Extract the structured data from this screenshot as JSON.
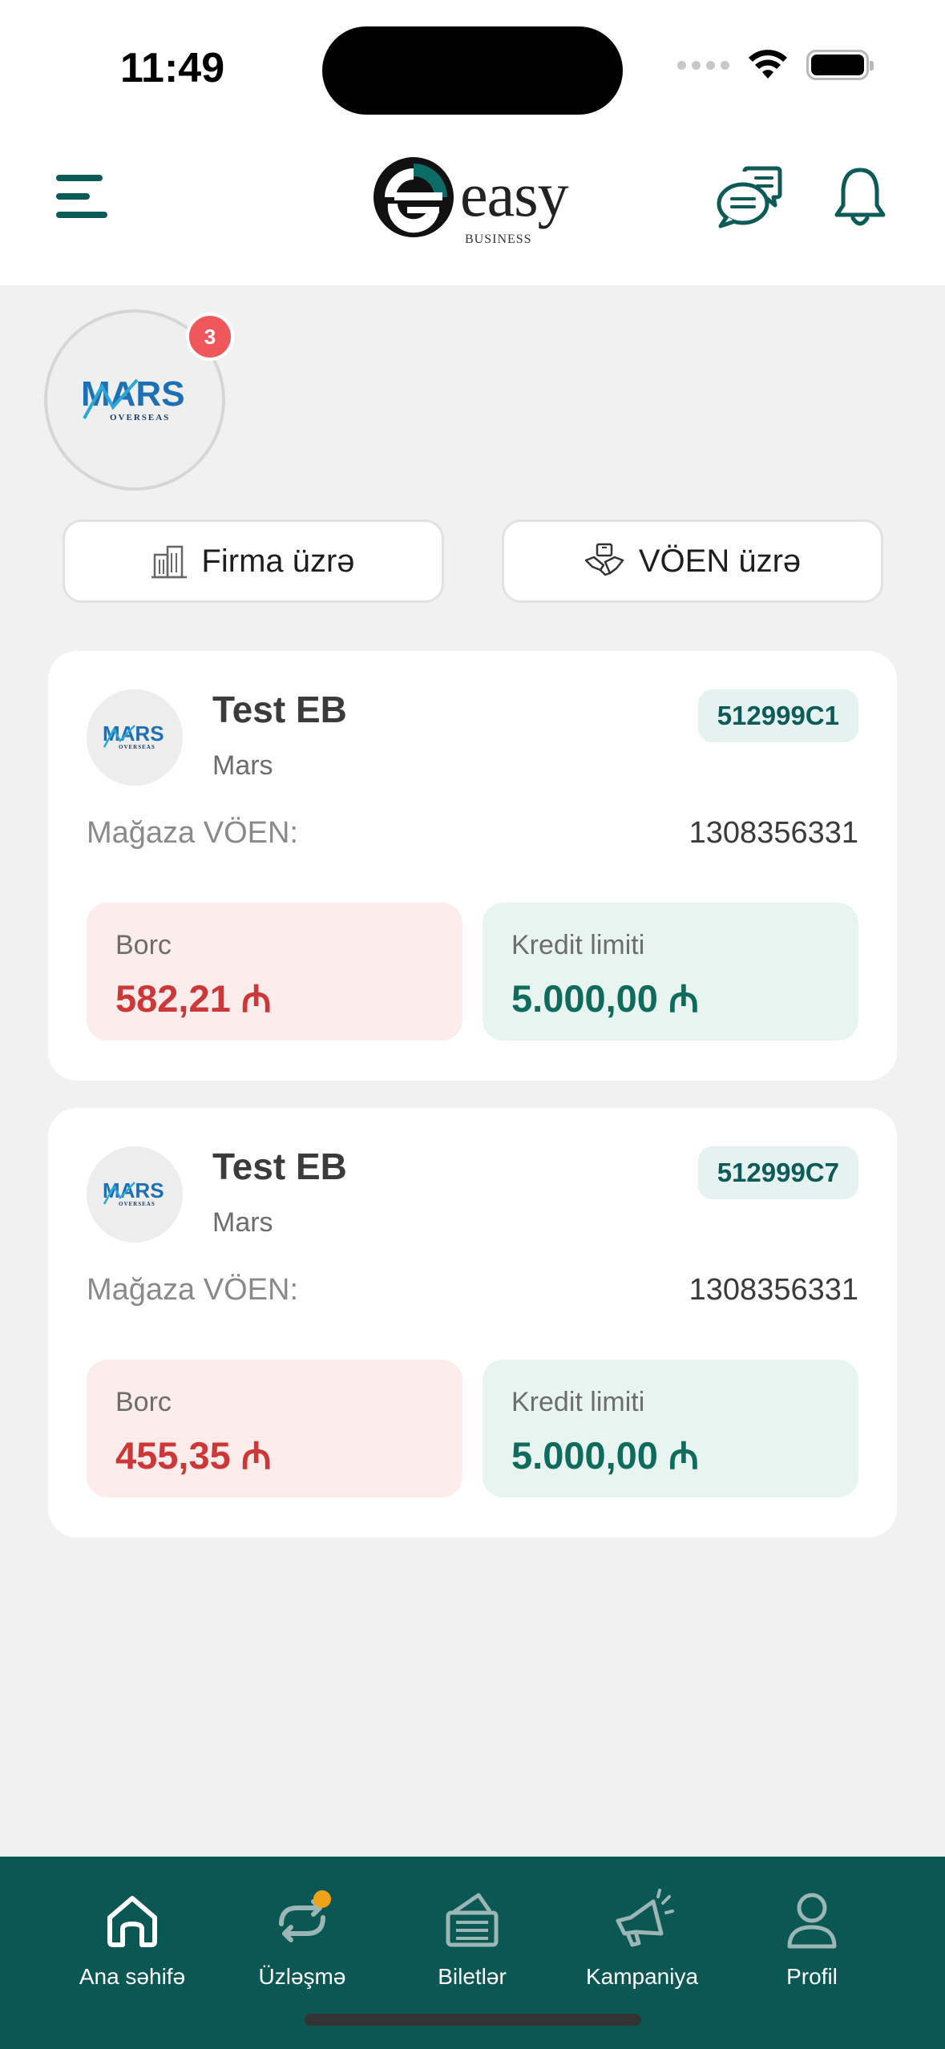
{
  "status_bar": {
    "time": "11:49"
  },
  "header": {
    "logo_word": "easy",
    "logo_sub": "BUSINESS",
    "menu_icon": "hamburger-menu-icon",
    "chat_icon": "chat-bubbles-icon",
    "bell_icon": "bell-icon"
  },
  "merchant": {
    "name": "MARS",
    "sub": "OVERSEAS",
    "badge_count": "3"
  },
  "filters": {
    "firma_label": "Firma üzrə",
    "voen_label": "VÖEN üzrə"
  },
  "cards": [
    {
      "title": "Test EB",
      "subtitle": "Mars",
      "code": "512999C1",
      "voen_label": "Mağaza VÖEN:",
      "voen_value": "1308356331",
      "debt_label": "Borc",
      "debt_value": "582,21 ₼",
      "credit_label": "Kredit limiti",
      "credit_value": "5.000,00 ₼"
    },
    {
      "title": "Test EB",
      "subtitle": "Mars",
      "code": "512999C7",
      "voen_label": "Mağaza VÖEN:",
      "voen_value": "1308356331",
      "debt_label": "Borc",
      "debt_value": "455,35 ₼",
      "credit_label": "Kredit limiti",
      "credit_value": "5.000,00 ₼"
    }
  ],
  "bottom_nav": [
    {
      "label": "Ana səhifə",
      "icon": "home-icon"
    },
    {
      "label": "Üzləşmə",
      "icon": "sync-icon"
    },
    {
      "label": "Biletlər",
      "icon": "ticket-icon"
    },
    {
      "label": "Kampaniya",
      "icon": "megaphone-icon"
    },
    {
      "label": "Profil",
      "icon": "profile-icon"
    }
  ],
  "colors": {
    "primary": "#0b5754",
    "debt": "#cc3838",
    "credit": "#0f6b5c",
    "badge": "#f0575c",
    "nav_dot": "#f0a316"
  }
}
